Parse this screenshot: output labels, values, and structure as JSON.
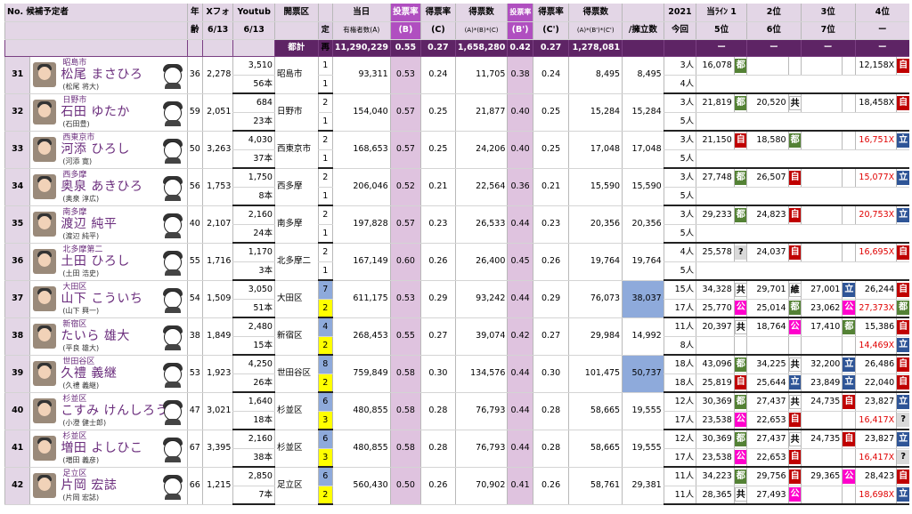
{
  "header": {
    "no_title": "No. 候補予定者",
    "age_label_1": "年",
    "age_label_2": "齢",
    "x_label": "Xフォ",
    "x_date": "6/13",
    "yt_label": "Youtub",
    "yt_date": "6/13",
    "district_label": "開票区",
    "seats_label": "定",
    "reelect_label": "再",
    "reg_label": "当日",
    "reg_sub": "有権者数(A)",
    "turnout_label": "投票率",
    "turnout_sub": "(B)",
    "vote_rate_label": "得票率",
    "vote_rate_sub": "(C)",
    "votes_label": "得票数",
    "votes_sub": "(A)*(B)*(C)",
    "turnout2_label": "投票率",
    "turnout2_sub": "(B')",
    "vote_rate2_label": "得票率",
    "vote_rate2_sub": "(C')",
    "votes2_label": "得票数",
    "votes2_sub": "(A)*(B')*(C')",
    "perhead_label": "/擁立数",
    "year_label": "2021",
    "year_sub": "今回",
    "rank1_label": "当ﾗｲﾝ 1",
    "rank1_sub": "5位",
    "rank2_label": "2位",
    "rank2_sub": "6位",
    "rank3_label": "3位",
    "rank3_sub": "7位",
    "rank4_label": "4位",
    "rank4_sub": "ー"
  },
  "totals": {
    "label": "都計",
    "registered": "11,290,229",
    "turnout": "0.55",
    "vote_rate": "0.27",
    "votes": "1,658,280",
    "turnout2": "0.42",
    "vote_rate2": "0.27",
    "votes2": "1,278,081",
    "dash": "ー"
  },
  "rows": [
    {
      "no": "31",
      "district": "昭島市",
      "name": "松尾 まさひろ",
      "real": "(松尾 将大)",
      "age": "36",
      "x": "2,278",
      "yt": "3,510",
      "yt_sub": "56本",
      "area": "昭島市",
      "seats": "1",
      "re": "1",
      "reg": "93,311",
      "t": "0.53",
      "c": "0.24",
      "v": "11,705",
      "t2": "0.38",
      "c2": "0.24",
      "v2": "8,495",
      "per": "8,495",
      "ppl": "3人",
      "ppl2": "4人",
      "r1v": "16,078",
      "r1p": "都",
      "r2v": "",
      "r2p": "",
      "r3v": "",
      "r3p": "",
      "r4v": "12,158X",
      "r4p": "自",
      "r4red": false
    },
    {
      "no": "32",
      "district": "日野市",
      "name": "石田 ゆたか",
      "real": "(石田豊)",
      "age": "59",
      "x": "2,051",
      "yt": "684",
      "yt_sub": "23本",
      "area": "日野市",
      "seats": "2",
      "re": "1",
      "reg": "154,040",
      "t": "0.57",
      "c": "0.25",
      "v": "21,877",
      "t2": "0.40",
      "c2": "0.25",
      "v2": "15,284",
      "per": "15,284",
      "ppl": "3人",
      "ppl2": "5人",
      "r1v": "21,819",
      "r1p": "都",
      "r2v": "20,520",
      "r2p": "共",
      "r3v": "",
      "r3p": "",
      "r4v": "18,458X",
      "r4p": "自",
      "r4red": false
    },
    {
      "no": "33",
      "district": "西東京市",
      "name": "河添 ひろし",
      "real": "(河添 寛)",
      "age": "50",
      "x": "3,263",
      "yt": "4,030",
      "yt_sub": "37本",
      "area": "西東京市",
      "seats": "2",
      "re": "1",
      "reg": "168,653",
      "t": "0.57",
      "c": "0.25",
      "v": "24,206",
      "t2": "0.40",
      "c2": "0.25",
      "v2": "17,048",
      "per": "17,048",
      "ppl": "3人",
      "ppl2": "5人",
      "r1v": "21,150",
      "r1p": "自",
      "r2v": "18,580",
      "r2p": "都",
      "r3v": "",
      "r3p": "",
      "r4v": "16,751X",
      "r4p": "立",
      "r4red": true
    },
    {
      "no": "34",
      "district": "西多摩",
      "name": "奥泉 あきひろ",
      "real": "(奥泉 淳広)",
      "age": "56",
      "x": "1,753",
      "yt": "1,750",
      "yt_sub": "8本",
      "area": "西多摩",
      "seats": "2",
      "re": "1",
      "reg": "206,046",
      "t": "0.52",
      "c": "0.21",
      "v": "22,564",
      "t2": "0.36",
      "c2": "0.21",
      "v2": "15,590",
      "per": "15,590",
      "ppl": "3人",
      "ppl2": "5人",
      "r1v": "27,748",
      "r1p": "都",
      "r2v": "26,507",
      "r2p": "自",
      "r3v": "",
      "r3p": "",
      "r4v": "15,077X",
      "r4p": "立",
      "r4red": true
    },
    {
      "no": "35",
      "district": "南多摩",
      "name": "渡辺 純平",
      "real": "(渡辺 純平)",
      "age": "40",
      "x": "2,107",
      "yt": "2,160",
      "yt_sub": "24本",
      "area": "南多摩",
      "seats": "2",
      "re": "1",
      "reg": "197,828",
      "t": "0.57",
      "c": "0.23",
      "v": "26,533",
      "t2": "0.44",
      "c2": "0.23",
      "v2": "20,356",
      "per": "20,356",
      "ppl": "3人",
      "ppl2": "5人",
      "r1v": "29,233",
      "r1p": "都",
      "r2v": "24,823",
      "r2p": "自",
      "r3v": "",
      "r3p": "",
      "r4v": "20,753X",
      "r4p": "立",
      "r4red": true
    },
    {
      "no": "36",
      "district": "北多摩第二",
      "name": "土田 ひろし",
      "real": "(土田 浩史)",
      "age": "55",
      "x": "1,716",
      "yt": "1,170",
      "yt_sub": "3本",
      "area": "北多摩二",
      "seats": "2",
      "re": "1",
      "reg": "167,149",
      "t": "0.60",
      "c": "0.26",
      "v": "26,400",
      "t2": "0.45",
      "c2": "0.26",
      "v2": "19,764",
      "per": "19,764",
      "ppl": "4人",
      "ppl2": "5人",
      "r1v": "25,578",
      "r1p": "?",
      "r2v": "24,037",
      "r2p": "自",
      "r3v": "",
      "r3p": "",
      "r4v": "16,695X",
      "r4p": "自",
      "r4red": true
    }
  ],
  "multi_rows": [
    {
      "no": "37",
      "district": "大田区",
      "name": "山下 こういち",
      "real": "(山下 興一)",
      "age": "54",
      "x": "1,509",
      "yt": "3,050",
      "yt_sub": "51本",
      "area": "大田区",
      "seats": "7",
      "re": "2",
      "reg": "611,175",
      "t": "0.53",
      "c": "0.29",
      "v": "93,242",
      "t2": "0.44",
      "c2": "0.29",
      "v2": "76,073",
      "per": "38,037",
      "hl": true,
      "a": {
        "ppl": "15人",
        "r1v": "34,328",
        "r1p": "共",
        "r2v": "29,701",
        "r2p": "維",
        "r3v": "27,001",
        "r3p": "立",
        "r4v": "26,244",
        "r4p": "自",
        "r4red": false
      },
      "b": {
        "ppl": "17人",
        "r1v": "25,770",
        "r1p": "公",
        "r2v": "25,014",
        "r2p": "都",
        "r3v": "23,062",
        "r3p": "公",
        "r4v": "27,373X",
        "r4p": "都",
        "r4red": true
      }
    },
    {
      "no": "38",
      "district": "新宿区",
      "name": "たいら 雄大",
      "real": "(平良 雄大)",
      "age": "38",
      "x": "1,849",
      "yt": "2,480",
      "yt_sub": "15本",
      "area": "新宿区",
      "seats": "4",
      "re": "2",
      "reg": "268,453",
      "t": "0.55",
      "c": "0.27",
      "v": "39,074",
      "t2": "0.42",
      "c2": "0.27",
      "v2": "29,984",
      "per": "14,992",
      "hl": false,
      "a": {
        "ppl": "11人",
        "r1v": "20,397",
        "r1p": "共",
        "r2v": "18,764",
        "r2p": "公",
        "r3v": "17,410",
        "r3p": "都",
        "r4v": "15,386",
        "r4p": "自",
        "r4red": false
      },
      "b": {
        "ppl": "8人",
        "r1v": "",
        "r1p": "",
        "r2v": "",
        "r2p": "",
        "r3v": "",
        "r3p": "",
        "r4v": "14,469X",
        "r4p": "立",
        "r4red": true
      }
    },
    {
      "no": "39",
      "district": "世田谷区",
      "name": "久禮 義継",
      "real": "(久禮 義継)",
      "age": "53",
      "x": "1,923",
      "yt": "4,250",
      "yt_sub": "26本",
      "area": "世田谷区",
      "seats": "8",
      "re": "2",
      "reg": "759,849",
      "t": "0.58",
      "c": "0.30",
      "v": "134,576",
      "t2": "0.44",
      "c2": "0.30",
      "v2": "101,475",
      "per": "50,737",
      "hl": true,
      "a": {
        "ppl": "18人",
        "r1v": "43,096",
        "r1p": "都",
        "r2v": "34,225",
        "r2p": "共",
        "r3v": "32,200",
        "r3p": "立",
        "r4v": "26,486",
        "r4p": "自",
        "r4red": false
      },
      "b": {
        "ppl": "18人",
        "r1v": "25,819",
        "r1p": "自",
        "r2v": "25,644",
        "r2p": "立",
        "r3v": "23,849",
        "r3p": "立",
        "r4v": "22,040",
        "r4p": "自",
        "r4red": false
      }
    },
    {
      "no": "40",
      "district": "杉並区",
      "name": "こすみ けんしろう",
      "real": "(小澄 健士郎)",
      "age": "47",
      "x": "3,021",
      "yt": "1,640",
      "yt_sub": "18本",
      "area": "杉並区",
      "seats": "6",
      "re": "3",
      "reg": "480,855",
      "t": "0.58",
      "c": "0.28",
      "v": "76,793",
      "t2": "0.44",
      "c2": "0.28",
      "v2": "58,665",
      "per": "19,555",
      "hl": false,
      "a": {
        "ppl": "12人",
        "r1v": "30,369",
        "r1p": "都",
        "r2v": "27,437",
        "r2p": "共",
        "r3v": "24,735",
        "r3p": "自",
        "r4v": "23,827",
        "r4p": "立",
        "r4red": false
      },
      "b": {
        "ppl": "17人",
        "r1v": "23,538",
        "r1p": "公",
        "r2v": "22,653",
        "r2p": "自",
        "r3v": "",
        "r3p": "",
        "r4v": "16,417X",
        "r4p": "?",
        "r4red": true
      }
    },
    {
      "no": "41",
      "district": "杉並区",
      "name": "増田 よしひこ",
      "real": "(増田 義彦)",
      "age": "67",
      "x": "3,395",
      "yt": "2,160",
      "yt_sub": "38本",
      "area": "杉並区",
      "seats": "6",
      "re": "3",
      "reg": "480,855",
      "t": "0.58",
      "c": "0.28",
      "v": "76,793",
      "t2": "0.44",
      "c2": "0.28",
      "v2": "58,665",
      "per": "19,555",
      "hl": false,
      "a": {
        "ppl": "12人",
        "r1v": "30,369",
        "r1p": "都",
        "r2v": "27,437",
        "r2p": "共",
        "r3v": "24,735",
        "r3p": "自",
        "r4v": "23,827",
        "r4p": "立",
        "r4red": false
      },
      "b": {
        "ppl": "17人",
        "r1v": "23,538",
        "r1p": "公",
        "r2v": "22,653",
        "r2p": "自",
        "r3v": "",
        "r3p": "",
        "r4v": "16,417X",
        "r4p": "?",
        "r4red": true
      }
    },
    {
      "no": "42",
      "district": "足立区",
      "name": "片岡 宏誌",
      "real": "(片岡 宏誌)",
      "age": "66",
      "x": "1,215",
      "yt": "2,850",
      "yt_sub": "7本",
      "area": "足立区",
      "seats": "6",
      "re": "2",
      "reg": "560,430",
      "t": "0.50",
      "c": "0.26",
      "v": "70,902",
      "t2": "0.41",
      "c2": "0.26",
      "v2": "58,761",
      "per": "29,381",
      "hl": false,
      "a": {
        "ppl": "11人",
        "r1v": "34,223",
        "r1p": "都",
        "r2v": "29,756",
        "r2p": "自",
        "r3v": "29,365",
        "r3p": "公",
        "r4v": "28,423",
        "r4p": "自",
        "r4red": false
      },
      "b": {
        "ppl": "11人",
        "r1v": "28,365",
        "r1p": "共",
        "r2v": "27,493",
        "r2p": "公",
        "r3v": "",
        "r3p": "",
        "r4v": "18,698X",
        "r4p": "立",
        "r4red": true
      }
    }
  ],
  "party_colors": {
    "自": "#c00000",
    "都": "#548235",
    "共": "#ffffff",
    "公": "#ff00cc",
    "立": "#2f5597",
    "維": "#ffffff",
    "?": "#d9d9d9"
  }
}
